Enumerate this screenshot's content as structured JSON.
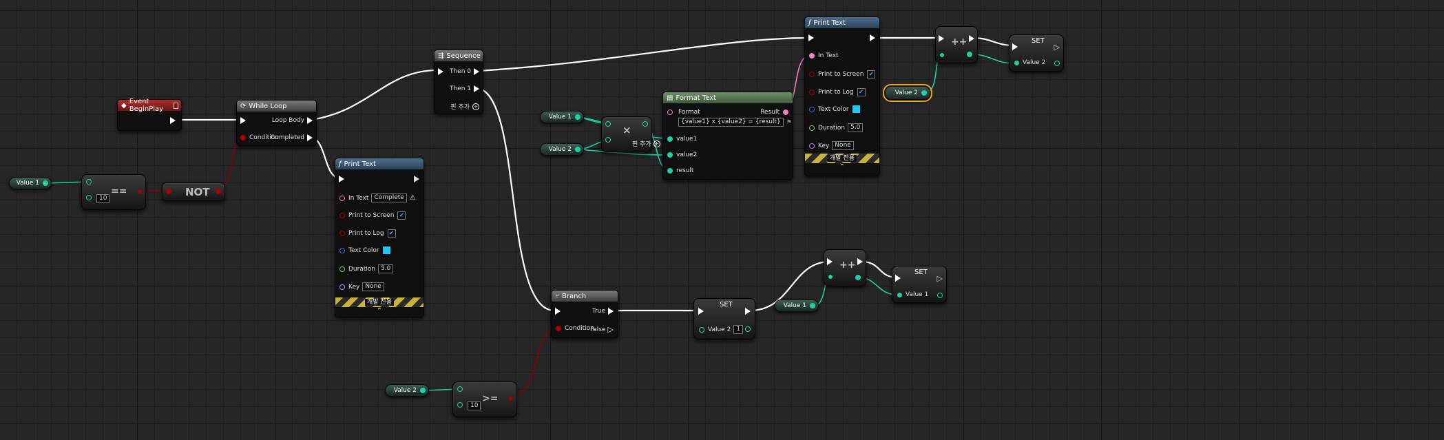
{
  "colors": {
    "exec": "#ffffff",
    "int": "#1dd1a1",
    "bool": "#a00000",
    "string": "#f07fbf",
    "struct": "#2a6fe0",
    "float": "#7ac241",
    "name": "#b17ae8"
  },
  "event_begin_play": {
    "title": "Event BeginPlay"
  },
  "while_loop": {
    "title": "While Loop",
    "loop_body": "Loop Body",
    "condition": "Condition",
    "completed": "Completed"
  },
  "sequence": {
    "title": "Sequence",
    "then0": "Then 0",
    "then1": "Then 1",
    "add_pin": "핀 추가"
  },
  "print_text_1": {
    "title": "Print Text",
    "in_text": "In Text",
    "in_text_value": "Complete",
    "print_to_screen": "Print to Screen",
    "print_to_log": "Print to Log",
    "text_color": "Text Color",
    "duration": "Duration",
    "duration_value": "5.0",
    "key": "Key",
    "key_value": "None",
    "dev_only": "개발 전용"
  },
  "print_text_2": {
    "title": "Print Text",
    "in_text": "In Text",
    "print_to_screen": "Print to Screen",
    "print_to_log": "Print to Log",
    "text_color": "Text Color",
    "duration": "Duration",
    "duration_value": "5.0",
    "key": "Key",
    "key_value": "None",
    "dev_only": "개발 전용"
  },
  "format_text": {
    "title": "Format Text",
    "format": "Format",
    "format_value": "{value1} x {value2} = {result}",
    "result": "Result",
    "value1": "value1",
    "value2": "value2",
    "result_pin": "result"
  },
  "branch": {
    "title": "Branch",
    "true_label": "True",
    "condition": "Condition",
    "false_label": "False"
  },
  "set_1": {
    "title": "SET",
    "var": "Value 2",
    "var_value": "1"
  },
  "set_2": {
    "title": "SET",
    "var": "Value 1"
  },
  "set_3": {
    "title": "SET",
    "var": "Value 2"
  },
  "multiply": {
    "symbol": "×",
    "add_pin": "핀 추가"
  },
  "equals": {
    "symbol": "==",
    "value": "10"
  },
  "not_node": {
    "symbol": "NOT"
  },
  "gte": {
    "symbol": ">=",
    "value": "10"
  },
  "inc_1": {
    "symbol": "++"
  },
  "inc_2": {
    "symbol": "++"
  },
  "vars": {
    "value1_a": "Value 1",
    "value1_b": "Value 1",
    "value2_a": "Value 2",
    "value2_b": "Value 2",
    "value2_c": "Value 2",
    "value1_c": "Value 1"
  }
}
